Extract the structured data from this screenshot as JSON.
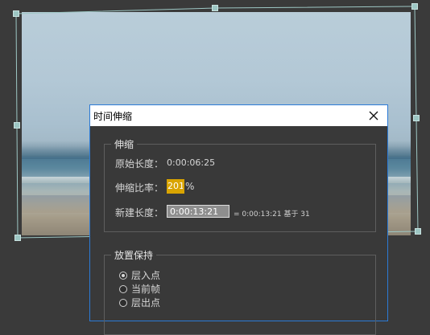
{
  "dialog": {
    "title": "时间伸缩",
    "stretch_group": {
      "legend": "伸缩",
      "original_duration_label": "原始长度：",
      "original_duration_value": "0:00:06:25",
      "stretch_factor_label": "伸缩比率：",
      "stretch_factor_value": "201",
      "stretch_factor_unit": "%",
      "new_duration_label": "新建长度：",
      "new_duration_value": "0:00:13:21",
      "new_duration_info": "= 0:00:13:21  基于 31"
    },
    "hold_group": {
      "legend": "放置保持",
      "options": [
        {
          "label": "层入点",
          "checked": true
        },
        {
          "label": "当前帧",
          "checked": false
        },
        {
          "label": "层出点",
          "checked": false
        }
      ]
    }
  },
  "colors": {
    "accent_border": "#2b7ad6",
    "ratio_highlight": "#d9a400",
    "handle": "#9dc7c4"
  },
  "icons": {
    "close": "close-icon"
  }
}
